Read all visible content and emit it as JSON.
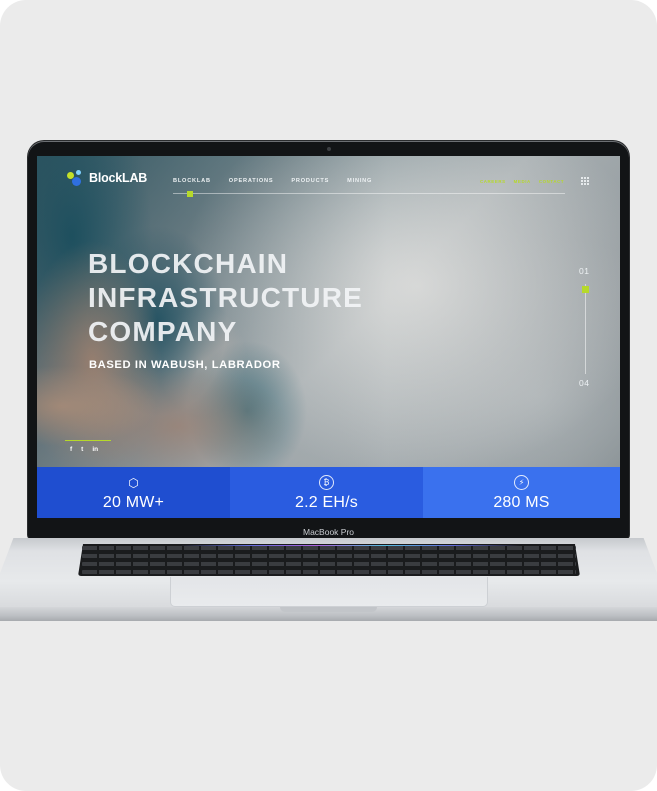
{
  "device": {
    "label": "MacBook Pro"
  },
  "site": {
    "logo": "BlockLAB",
    "nav_main": [
      "BLOCKLAB",
      "OPERATIONS",
      "PRODUCTS",
      "MINING"
    ],
    "nav_right": [
      "CAREERS",
      "MEDIA",
      "CONTACT"
    ],
    "hero": {
      "title_lines": [
        "BLOCKCHAIN",
        "INFRASTRUCTURE",
        "COMPANY"
      ],
      "subtitle": "BASED IN WABUSH, LABRADOR"
    },
    "slider": {
      "current": "01",
      "total": "04",
      "position_fraction": 0.0
    },
    "social": [
      "f",
      "t",
      "in"
    ],
    "stats": [
      {
        "icon": "cube-network-icon",
        "value": "20 MW+"
      },
      {
        "icon": "bitcoin-icon",
        "value": "2.2 EH/s"
      },
      {
        "icon": "lightning-icon",
        "value": "280 MS"
      }
    ],
    "colors": {
      "accent_lime": "#b6d92a",
      "stat_blue_1": "#1f4ed0",
      "stat_blue_2": "#2a5ce0",
      "stat_blue_3": "#3a71ee"
    }
  }
}
